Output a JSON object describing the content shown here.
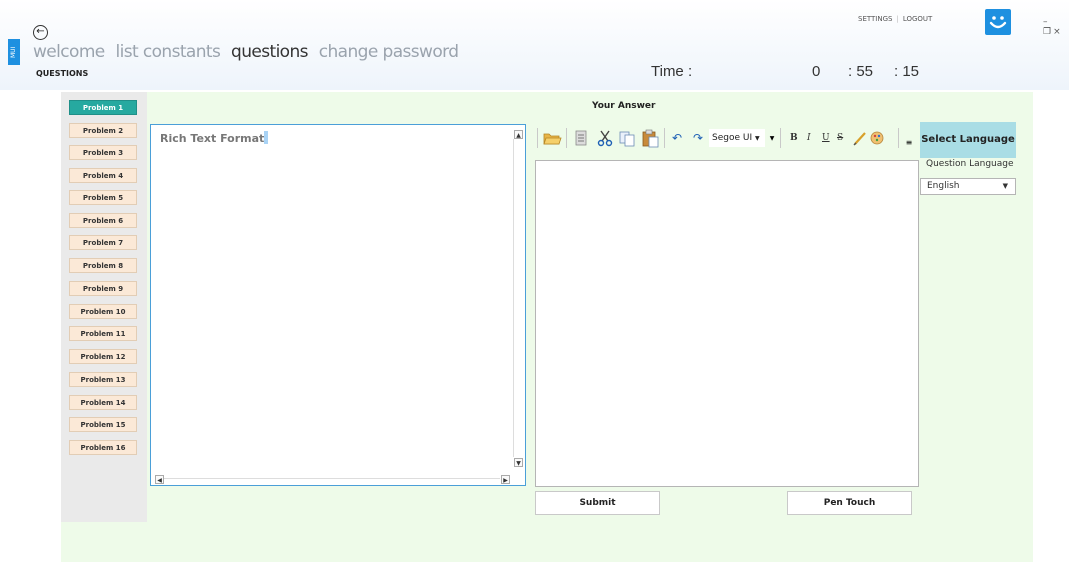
{
  "app": {
    "side_tag": "MUI",
    "nav": [
      "welcome",
      "list constants",
      "questions",
      "change password"
    ],
    "active_nav": "questions",
    "section_title": "QUESTIONS",
    "settings": "SETTINGS",
    "logout": "LOGOUT",
    "separator": "|"
  },
  "timer": {
    "label": "Time :",
    "hours": "0",
    "minutes": ": 55",
    "seconds": ": 15"
  },
  "problems": [
    "Problem 1",
    "Problem 2",
    "Problem 3",
    "Problem 4",
    "Problem 5",
    "Problem 6",
    "Problem 7",
    "Problem 8",
    "Problem 9",
    "Problem 10",
    "Problem 11",
    "Problem 12",
    "Problem 13",
    "Problem 14",
    "Problem 15",
    "Problem 16"
  ],
  "active_problem": "Problem 1",
  "question": {
    "text": "Rich Text Format"
  },
  "answer": {
    "title": "Your Answer",
    "font": "Segoe UI",
    "bold": "B",
    "italic": "I",
    "underline": "U",
    "strike": "S",
    "submit": "Submit",
    "pen_touch": "Pen Touch"
  },
  "language": {
    "header": "Select Language",
    "label": "Question Language",
    "selected": "English"
  },
  "colors": {
    "accent_blue": "#1e90e0",
    "active_problem": "#26a9a0",
    "problem_bg": "#fbe9d7",
    "main_bg": "#eefbe9",
    "lang_header": "#a9dde5"
  }
}
